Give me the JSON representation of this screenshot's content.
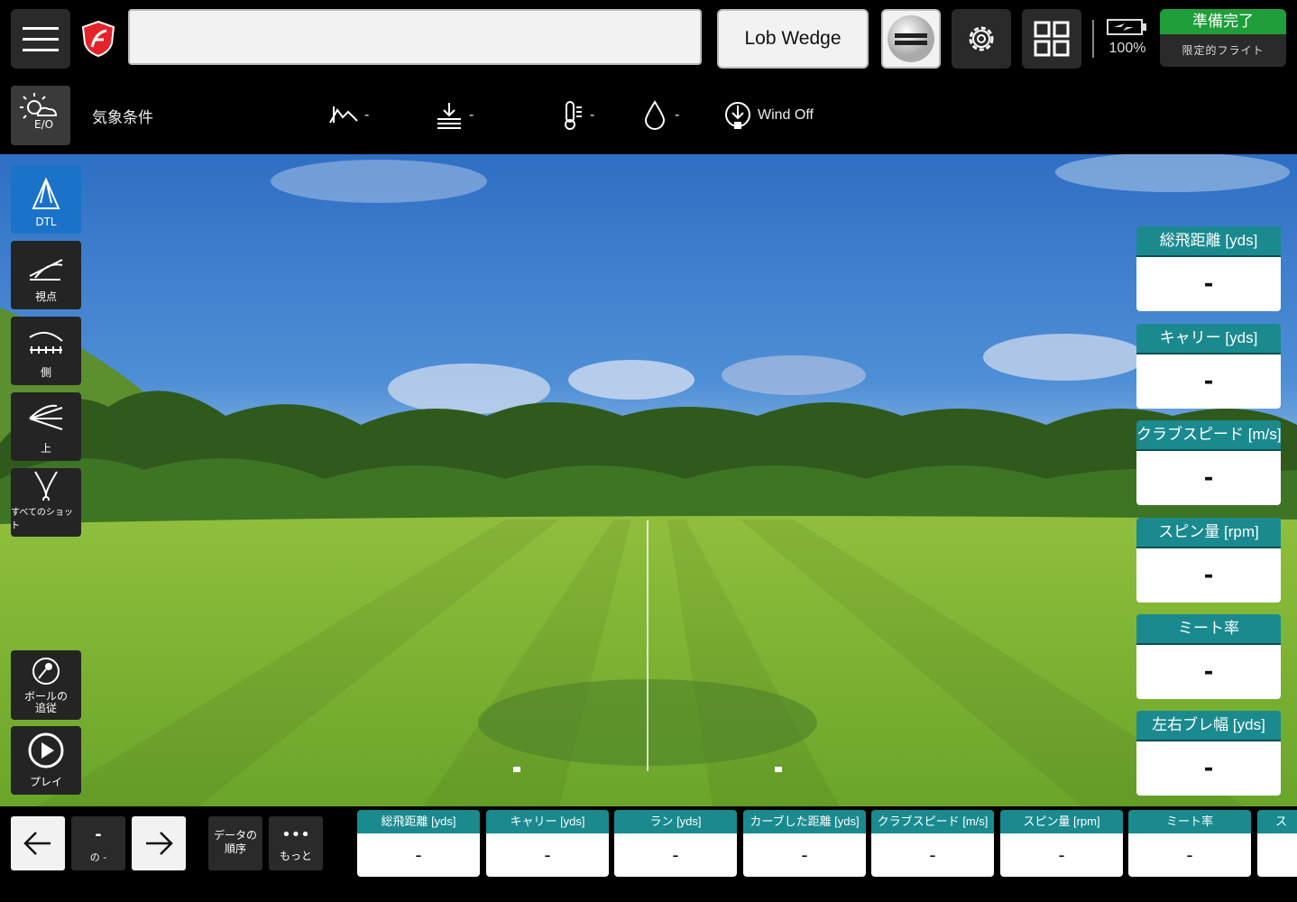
{
  "header": {
    "search_value": "",
    "club": "Lob Wedge",
    "battery": "100%",
    "status_main": "準備完了",
    "status_sub": "限定的フライト"
  },
  "weather": {
    "badge": "E/O",
    "label": "気象条件",
    "altitude": "-",
    "pressure": "-",
    "temperature": "-",
    "humidity": "-",
    "wind": "Wind Off"
  },
  "views": [
    {
      "label": "DTL"
    },
    {
      "label": "視点"
    },
    {
      "label": "側"
    },
    {
      "label": "上"
    },
    {
      "label": "すべてのショット"
    }
  ],
  "actions": {
    "track_ball": "ボールの追従",
    "play": "プレイ"
  },
  "metrics": [
    {
      "label": "総飛距離 [yds]",
      "value": "-"
    },
    {
      "label": "キャリー [yds]",
      "value": "-"
    },
    {
      "label": "クラブスピード [m/s]",
      "value": "-"
    },
    {
      "label": "スピン量 [rpm]",
      "value": "-"
    },
    {
      "label": "ミート率",
      "value": "-"
    },
    {
      "label": "左右ブレ幅 [yds]",
      "value": "-"
    }
  ],
  "bottom": {
    "shot_number": "-",
    "of": "の -",
    "data_order": "データの順序",
    "more": "もっと",
    "cards": [
      {
        "label": "総飛距離 [yds]",
        "value": "-"
      },
      {
        "label": "キャリー [yds]",
        "value": "-"
      },
      {
        "label": "ラン [yds]",
        "value": "-"
      },
      {
        "label": "カーブした距離 [yds]",
        "value": "-"
      },
      {
        "label": "クラブスピード [m/s]",
        "value": "-"
      },
      {
        "label": "スピン量 [rpm]",
        "value": "-"
      },
      {
        "label": "ミート率",
        "value": "-"
      },
      {
        "label": "ス",
        "value": ""
      }
    ]
  },
  "colors": {
    "accent_blue": "#1a73c9",
    "teal": "#1a8a8f",
    "ready_green": "#1f9e3a"
  }
}
